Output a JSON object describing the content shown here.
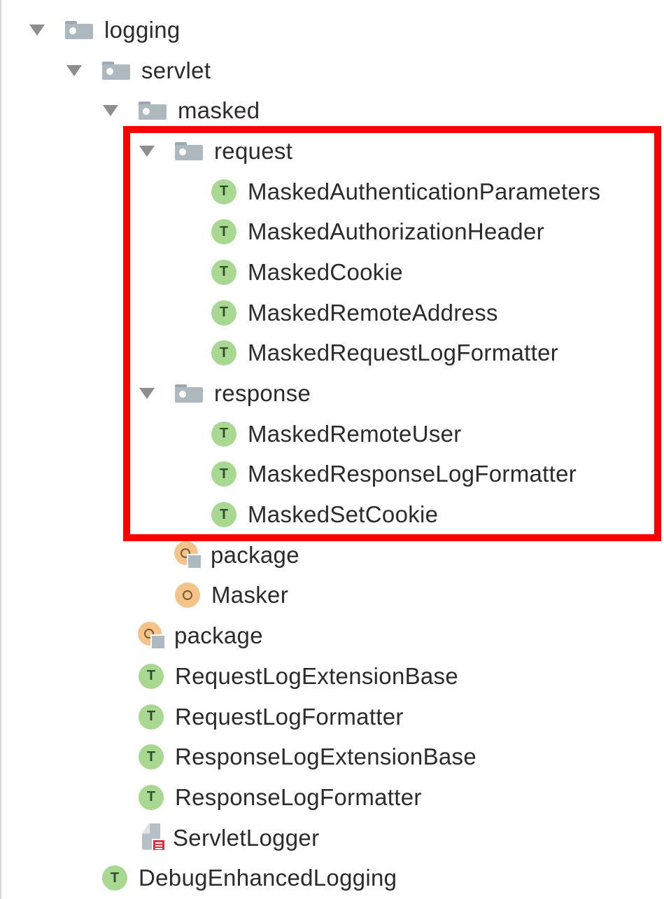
{
  "tree": {
    "logging": "logging",
    "servlet": "servlet",
    "masked": "masked",
    "request": "request",
    "request_children": [
      "MaskedAuthenticationParameters",
      "MaskedAuthorizationHeader",
      "MaskedCookie",
      "MaskedRemoteAddress",
      "MaskedRequestLogFormatter"
    ],
    "response": "response",
    "response_children": [
      "MaskedRemoteUser",
      "MaskedResponseLogFormatter",
      "MaskedSetCookie"
    ],
    "masked_package": "package",
    "masker": "Masker",
    "servlet_package": "package",
    "servlet_children": [
      "RequestLogExtensionBase",
      "RequestLogFormatter",
      "ResponseLogExtensionBase",
      "ResponseLogFormatter"
    ],
    "servlet_logger": "ServletLogger",
    "debug_enhanced_logging": "DebugEnhancedLogging"
  },
  "icons": {
    "trait_letter": "T",
    "trait": "trait-icon",
    "package_folder": "package-folder-icon",
    "package_object": "package-object-icon",
    "object": "object-icon",
    "scala_file": "scala-file-icon",
    "expand_arrow": "chevron-down-icon"
  },
  "colors": {
    "trait_bg": "#a8d891",
    "object_bg": "#f4c38a",
    "folder": "#aeb8bf",
    "highlight": "#ff0000",
    "file_badge": "#e0313a"
  }
}
